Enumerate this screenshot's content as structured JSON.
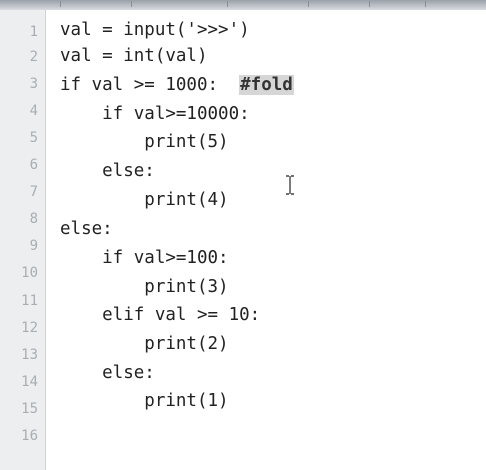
{
  "editor": {
    "line_numbers": [
      "1",
      "2",
      "3",
      "4",
      "5",
      "6",
      "7",
      "8",
      "9",
      "10",
      "11",
      "12",
      "13",
      "14",
      "15",
      "16"
    ],
    "lines": [
      "val = input('>>>')",
      "val = int(val)",
      "if val >= 1000:  ",
      "    if val>=10000:",
      "        print(5)",
      "    else:",
      "        print(4)",
      "else:",
      "    if val>=100:",
      "        print(3)",
      "    elif val >= 10:",
      "        print(2)",
      "    else:",
      "        print(1)",
      "",
      ""
    ],
    "fold_tag": "#fold"
  }
}
